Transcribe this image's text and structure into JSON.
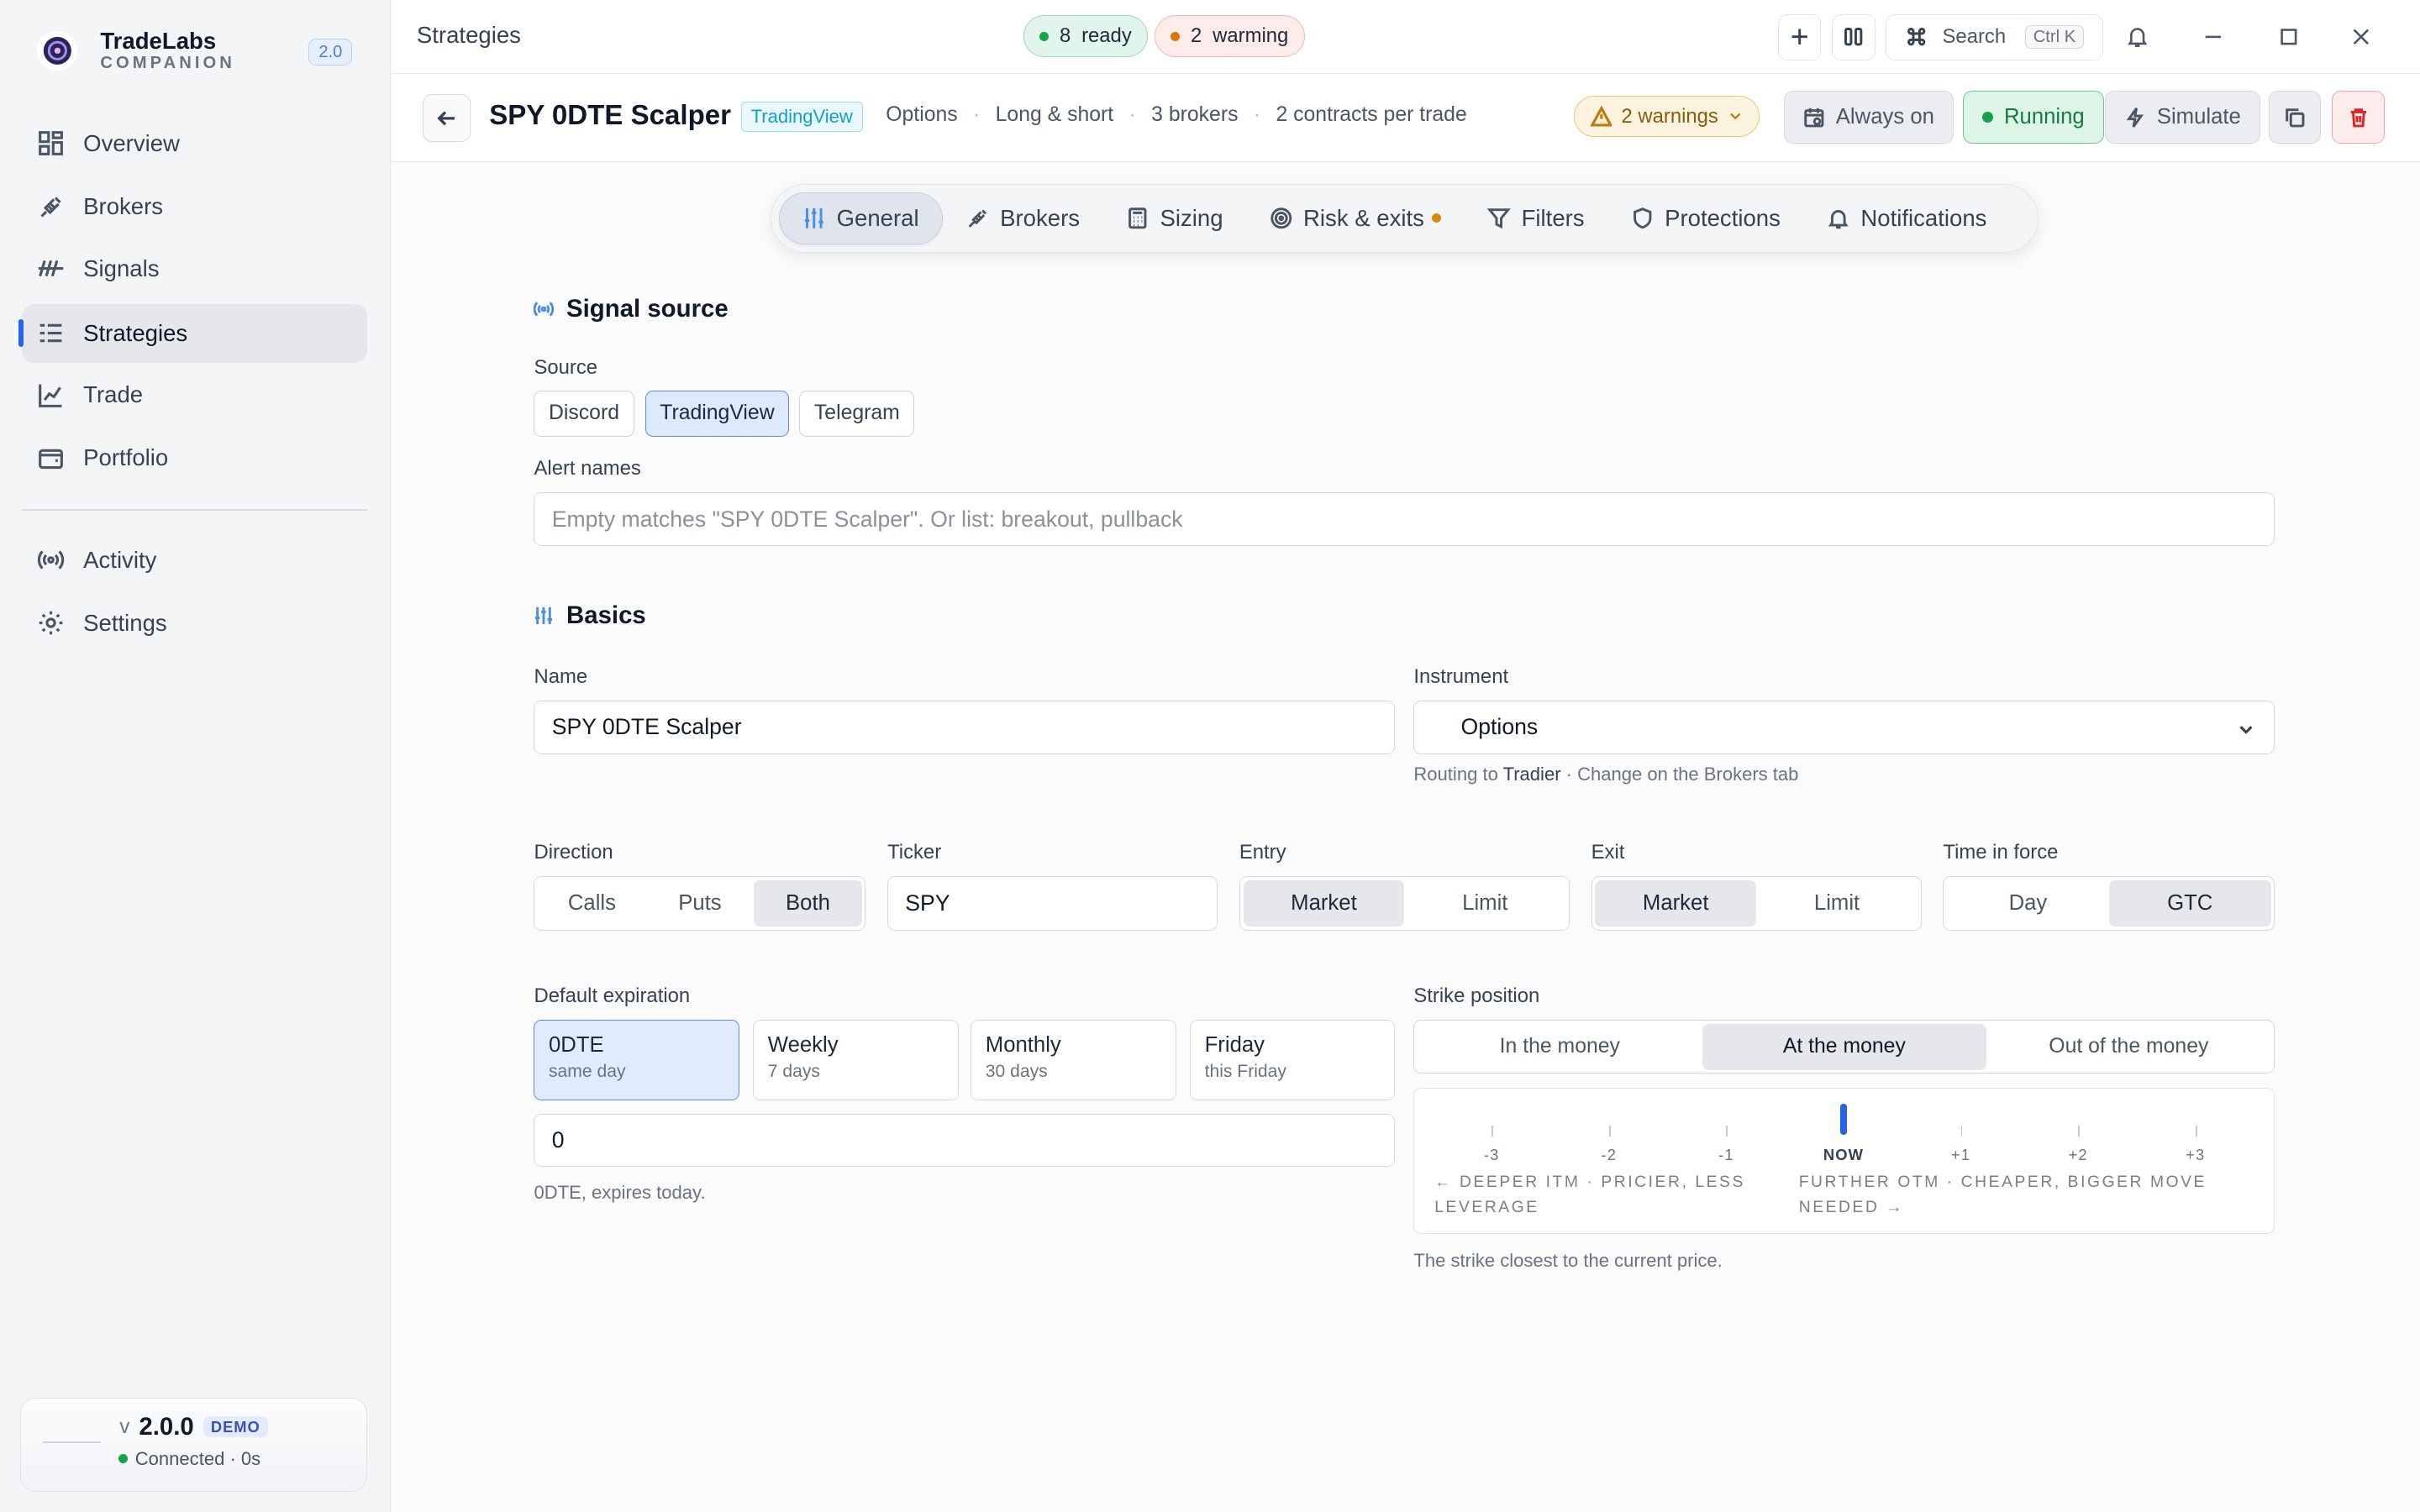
{
  "app": {
    "name": "TradeLabs",
    "subtitle": "COMPANION",
    "version_badge": "2.0"
  },
  "sidebar": {
    "items": [
      {
        "label": "Overview",
        "icon": "grid-icon"
      },
      {
        "label": "Brokers",
        "icon": "plug-icon"
      },
      {
        "label": "Signals",
        "icon": "signal-icon"
      },
      {
        "label": "Strategies",
        "icon": "list-icon",
        "active": true
      },
      {
        "label": "Trade",
        "icon": "chart-line-icon"
      },
      {
        "label": "Portfolio",
        "icon": "wallet-icon"
      },
      {
        "label": "Activity",
        "icon": "broadcast-icon"
      },
      {
        "label": "Settings",
        "icon": "gear-icon"
      }
    ],
    "footer": {
      "v": "v",
      "version": "2.0.0",
      "demo": "DEMO",
      "status": "Connected · 0s"
    }
  },
  "topbar": {
    "breadcrumb": "Strategies",
    "ready_count": "8",
    "ready_label": "ready",
    "warming_count": "2",
    "warming_label": "warming",
    "search_label": "Search",
    "search_kbd": "Ctrl K"
  },
  "strategy": {
    "title": "SPY 0DTE Scalper",
    "source_badge": "TradingView",
    "meta": [
      "Options",
      "Long & short",
      "3 brokers",
      "2 contracts per trade"
    ],
    "warnings": "2 warnings",
    "schedule": "Always on",
    "status": "Running",
    "simulate": "Simulate"
  },
  "tabs": [
    {
      "label": "General",
      "icon": "sliders-icon",
      "active": true
    },
    {
      "label": "Brokers",
      "icon": "plug-icon"
    },
    {
      "label": "Sizing",
      "icon": "calculator-icon"
    },
    {
      "label": "Risk & exits",
      "icon": "target-icon",
      "dot": true
    },
    {
      "label": "Filters",
      "icon": "filter-icon"
    },
    {
      "label": "Protections",
      "icon": "shield-icon"
    },
    {
      "label": "Notifications",
      "icon": "bell-icon"
    }
  ],
  "signal_source": {
    "title": "Signal source",
    "source_label": "Source",
    "sources": [
      "Discord",
      "TradingView",
      "Telegram"
    ],
    "selected": "TradingView",
    "alert_label": "Alert names",
    "alert_placeholder": "Empty matches \"SPY 0DTE Scalper\". Or list: breakout, pullback"
  },
  "basics": {
    "title": "Basics",
    "name_label": "Name",
    "name_value": "SPY 0DTE Scalper",
    "instrument_label": "Instrument",
    "instrument_value": "Options",
    "routing_prefix": "Routing to",
    "routing_broker": "Tradier",
    "routing_suffix": "· Change on the Brokers tab",
    "direction_label": "Direction",
    "direction_options": [
      "Calls",
      "Puts",
      "Both"
    ],
    "direction_selected": "Both",
    "ticker_label": "Ticker",
    "ticker_value": "SPY",
    "entry_label": "Entry",
    "entry_options": [
      "Market",
      "Limit"
    ],
    "entry_selected": "Market",
    "exit_label": "Exit",
    "exit_options": [
      "Market",
      "Limit"
    ],
    "exit_selected": "Market",
    "tif_label": "Time in force",
    "tif_options": [
      "Day",
      "GTC"
    ],
    "tif_selected": "GTC",
    "expiration_label": "Default expiration",
    "expirations": [
      {
        "title": "0DTE",
        "sub": "same day"
      },
      {
        "title": "Weekly",
        "sub": "7 days"
      },
      {
        "title": "Monthly",
        "sub": "30 days"
      },
      {
        "title": "Friday",
        "sub": "this Friday"
      }
    ],
    "expiration_selected": "0DTE",
    "expiration_days": "0",
    "expiration_hint": "0DTE, expires today.",
    "strike_label": "Strike position",
    "strike_options": [
      "In the money",
      "At the money",
      "Out of the money"
    ],
    "strike_selected": "At the money",
    "strike_ticks": [
      "-3",
      "-2",
      "-1",
      "NOW",
      "+1",
      "+2",
      "+3"
    ],
    "strike_left_note": "← DEEPER ITM · PRICIER, LESS LEVERAGE",
    "strike_right_note": "FURTHER OTM · CHEAPER, BIGGER MOVE NEEDED →",
    "strike_hint": "The strike closest to the current price."
  },
  "colors": {
    "accent": "#2563eb",
    "ready": "#16a34a",
    "warming": "#d97706",
    "danger": "#dc2626"
  }
}
